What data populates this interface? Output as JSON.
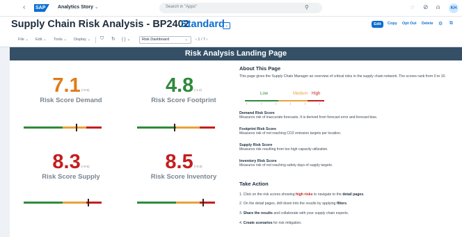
{
  "shell": {
    "back": "‹",
    "logo": "SAP",
    "app_name": "Analytics Story",
    "app_chevron": "⌄",
    "search_placeholder": "Search in \"Apps\"",
    "avatar": "KH"
  },
  "header": {
    "title": "Supply Chain Risk Analysis - BP2402",
    "variant": "Standard",
    "actions": {
      "edit": "Edit",
      "copy": "Copy",
      "opt_out": "Opt Out",
      "delete": "Delete"
    }
  },
  "toolbar": {
    "file": "File ⌄",
    "edit": "Edit ⌄",
    "tools": "Tools ⌄",
    "display": "Display ⌄",
    "page_select": "Risk Dashboard",
    "page_counter": "‹  1 / 7  ›"
  },
  "banner": "Risk Analysis Landing Page",
  "kpis": [
    {
      "value": "7.1",
      "delta": "(+0.6)",
      "label": "Risk Score Demand",
      "color": "#e07b18",
      "marker": 0.68
    },
    {
      "value": "4.8",
      "delta": "(-1.2)",
      "label": "Risk Score Footprint",
      "color": "#2f8a3b",
      "marker": 0.48
    },
    {
      "value": "8.3",
      "delta": "(+0.5)",
      "label": "Risk Score Supply",
      "color": "#c41e1e",
      "marker": 0.83
    },
    {
      "value": "8.5",
      "delta": "(+0.6)",
      "label": "Risk Score Inventory",
      "color": "#c41e1e",
      "marker": 0.85
    }
  ],
  "about": {
    "heading": "About This Page",
    "text": "This page gives the Supply Chain Manager an overview of critical risks in the supply chain network. The scores rank from 0 to 10.",
    "legend": {
      "low": "Low",
      "medium": "Medium",
      "high": "High"
    },
    "definitions": [
      {
        "title": "Demand Risk Score",
        "text": "Measures risk of inaccurate forecasts. It is derived from forecast error and forecast bias."
      },
      {
        "title": "Footprint Risk Score",
        "text": "Measures risk of not reaching CO2 emission targets per location."
      },
      {
        "title": "Supply Risk Score",
        "text": "Measures risk resulting from too high capacity utilization."
      },
      {
        "title": "Inventory Risk Score",
        "text": "Measures risk of not reaching safety days of supply targets."
      }
    ]
  },
  "take_action": {
    "heading": "Take Action",
    "steps": [
      {
        "a": "1. Click on the risk scores showing ",
        "b": "high risks",
        "c": " to navigate to the ",
        "d": "detail pages",
        "e": "."
      },
      {
        "a": "2. On the detail pages, drill down into the results by applying ",
        "b": "filters",
        "c": "."
      },
      {
        "a": "3. ",
        "b": "Share the results",
        "c": " and collaborate with your supply chain experts."
      },
      {
        "a": "4. ",
        "b": "Create scenarios",
        "c": " for risk mitigation."
      }
    ]
  },
  "colors": {
    "low": "#2f8a3b",
    "medium": "#e8a13a",
    "high": "#c41e1e",
    "accent": "#0a6ed1"
  }
}
